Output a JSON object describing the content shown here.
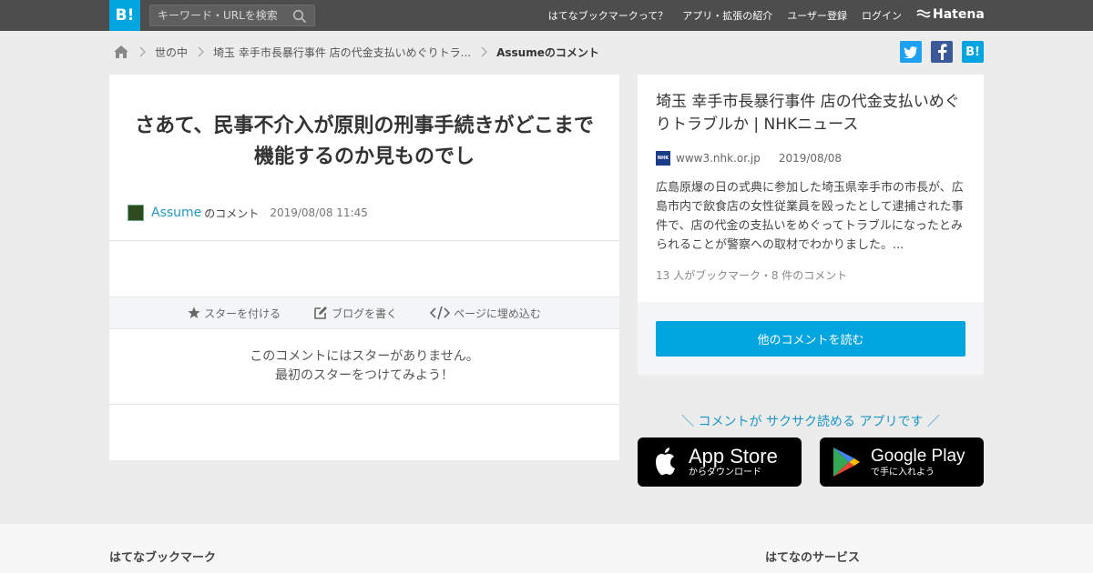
{
  "header": {
    "logo": "B!",
    "search_placeholder": "キーワード・URLを検索",
    "nav": [
      "はてなブックマークって？",
      "アプリ・拡張の紹介",
      "ユーザー登録",
      "ログイン"
    ],
    "brand": "Hatena"
  },
  "breadcrumb": {
    "items": [
      "世の中",
      "埼玉 幸手市長暴行事件 店の代金支払いめぐりトラ..."
    ],
    "current": "Assumeのコメント"
  },
  "share": {
    "twitter": "twitter-icon",
    "facebook": "facebook-icon",
    "hatebu": "B!"
  },
  "comment": {
    "text": "さあて、民事不介入が原則の刑事手続きがどこまで機能するのか見ものでし",
    "user": "Assume",
    "user_suffix": "のコメント",
    "date": "2019/08/08 11:45"
  },
  "actions": {
    "star": "スターを付ける",
    "blog": "ブログを書く",
    "embed": "ページに埋め込む"
  },
  "nostar": {
    "line1": "このコメントにはスターがありません。",
    "line2": "最初のスターをつけてみよう！"
  },
  "article": {
    "title": "埼玉 幸手市長暴行事件 店の代金支払いめぐりトラブルか | NHKニュース",
    "favicon": "NHK",
    "domain": "www3.nhk.or.jp",
    "date": "2019/08/08",
    "excerpt": "広島原爆の日の式典に参加した埼玉県幸手市の市長が、広島市内で飲食店の女性従業員を殴ったとして逮捕された事件で、店の代金の支払いをめぐってトラブルになったとみられることが警察への取材でわかりました。...",
    "meta": "13 人がブックマーク・8 件のコメント",
    "read_button": "他のコメントを読む"
  },
  "promo": {
    "text": "＼ コメントが サクサク読める アプリです ／",
    "appstore_big": "App Store",
    "appstore_small": "からダウンロード",
    "googleplay_big": "Google Play",
    "googleplay_small": "で手に入れよう"
  },
  "footer": {
    "left": "はてなブックマーク",
    "right": "はてなのサービス"
  },
  "colors": {
    "accent": "#00a4de",
    "topbar": "#4d4d4d",
    "link": "#2595c4"
  }
}
